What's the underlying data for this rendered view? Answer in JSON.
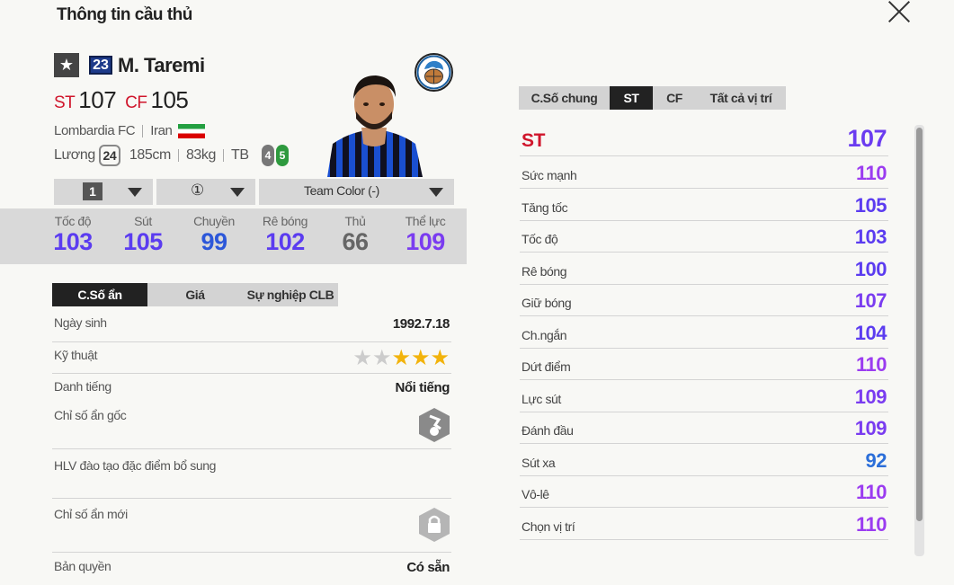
{
  "title": "Thông tin cầu thủ",
  "player": {
    "season_number": "23",
    "name": "M. Taremi",
    "positions": [
      {
        "pos": "ST",
        "ovr": "107"
      },
      {
        "pos": "CF",
        "ovr": "105"
      }
    ],
    "club": "Lombardia FC",
    "nation": "Iran",
    "salary_label": "Lương",
    "salary": "24",
    "height": "185cm",
    "weight": "83kg",
    "body_type": "TB",
    "left_foot": "4",
    "right_foot": "5"
  },
  "selectors": {
    "upgrade_level": "1",
    "level": "①",
    "team_color": "Team Color (-)"
  },
  "quick_stats": [
    {
      "label": "Tốc độ",
      "value": "103",
      "color": "#5b3cf0"
    },
    {
      "label": "Sút",
      "value": "105",
      "color": "#5b3cf0"
    },
    {
      "label": "Chuyền",
      "value": "99",
      "color": "#2c57d9"
    },
    {
      "label": "Rê bóng",
      "value": "102",
      "color": "#5b3cf0"
    },
    {
      "label": "Thủ",
      "value": "66",
      "color": "#666666"
    },
    {
      "label": "Thể lực",
      "value": "109",
      "color": "#7a3cf0"
    }
  ],
  "left_tabs": [
    "C.Số ẩn",
    "Giá",
    "Sự nghiệp CLB"
  ],
  "info": {
    "birth_label": "Ngày sinh",
    "birth": "1992.7.18",
    "skill_label": "Kỹ thuật",
    "skill_stars": 3,
    "skill_max": 5,
    "fame_label": "Danh tiếng",
    "fame": "Nổi tiếng",
    "hidden_original_label": "Chỉ số ẩn gốc",
    "coach_label": "HLV đào tạo đặc điểm bổ sung",
    "hidden_new_label": "Chỉ số ẩn mới",
    "rights_label": "Bản quyền",
    "rights": "Có sẵn"
  },
  "right_tabs": [
    "C.Số chung",
    "ST",
    "CF",
    "Tất cả vị trí"
  ],
  "attributes": {
    "position": "ST",
    "position_value": "107",
    "rows": [
      {
        "label": "Sức mạnh",
        "value": "110",
        "color": "#9b3cf0"
      },
      {
        "label": "Tăng tốc",
        "value": "105",
        "color": "#5b3cf0"
      },
      {
        "label": "Tốc độ",
        "value": "103",
        "color": "#5b3cf0"
      },
      {
        "label": "Rê bóng",
        "value": "100",
        "color": "#5b3cf0"
      },
      {
        "label": "Giữ bóng",
        "value": "107",
        "color": "#7a3cf0"
      },
      {
        "label": "Ch.ngắn",
        "value": "104",
        "color": "#5b3cf0"
      },
      {
        "label": "Dứt điểm",
        "value": "110",
        "color": "#9b3cf0"
      },
      {
        "label": "Lực sút",
        "value": "109",
        "color": "#7a3cf0"
      },
      {
        "label": "Đánh đầu",
        "value": "109",
        "color": "#7a3cf0"
      },
      {
        "label": "Sút xa",
        "value": "92",
        "color": "#2c6fd9"
      },
      {
        "label": "Vô-lê",
        "value": "110",
        "color": "#9b3cf0"
      },
      {
        "label": "Chọn vị trí",
        "value": "110",
        "color": "#9b3cf0"
      }
    ]
  }
}
